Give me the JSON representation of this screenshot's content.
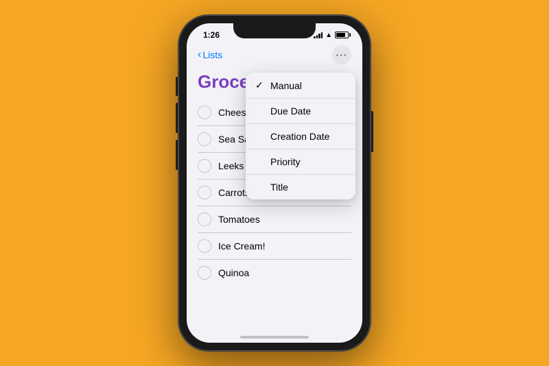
{
  "background_color": "#F5A623",
  "status_bar": {
    "time": "1:26"
  },
  "nav": {
    "back_label": "Lists",
    "more_icon": "···"
  },
  "page": {
    "title": "Grocery"
  },
  "list_items": [
    {
      "label": "Cheese"
    },
    {
      "label": "Sea Salt"
    },
    {
      "label": "Leeks"
    },
    {
      "label": "Carrots"
    },
    {
      "label": "Tomatoes"
    },
    {
      "label": "Ice Cream!"
    },
    {
      "label": "Quinoa"
    }
  ],
  "dropdown": {
    "items": [
      {
        "label": "Manual",
        "checked": true
      },
      {
        "label": "Due Date",
        "checked": false
      },
      {
        "label": "Creation Date",
        "checked": false
      },
      {
        "label": "Priority",
        "checked": false
      },
      {
        "label": "Title",
        "checked": false
      }
    ]
  }
}
